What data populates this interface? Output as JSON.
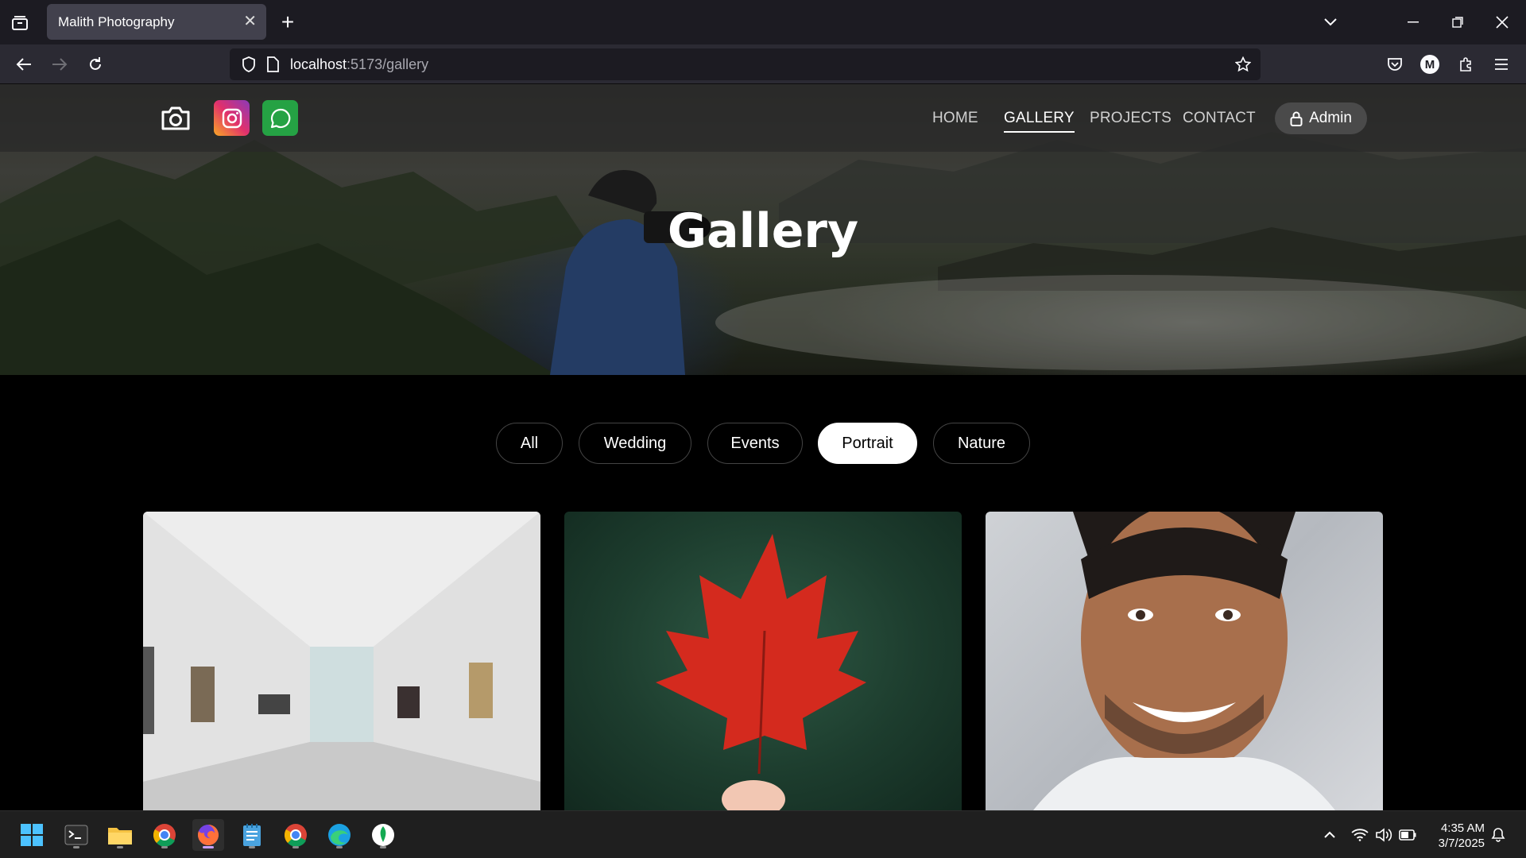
{
  "browser": {
    "tab_title": "Malith Photography",
    "url_host": "localhost",
    "url_path": ":5173/gallery",
    "profile_initial": "M"
  },
  "site": {
    "nav": [
      {
        "label": "HOME",
        "active": false
      },
      {
        "label": "GALLERY",
        "active": true
      },
      {
        "label": "PROJECTS",
        "active": false
      },
      {
        "label": "CONTACT",
        "active": false
      }
    ],
    "admin_label": "Admin",
    "hero_title": "Gallery",
    "filters": [
      {
        "label": "All",
        "active": false
      },
      {
        "label": "Wedding",
        "active": false
      },
      {
        "label": "Events",
        "active": false
      },
      {
        "label": "Portrait",
        "active": true
      },
      {
        "label": "Nature",
        "active": false
      }
    ],
    "gallery": [
      {
        "subject": "art-gallery-interior"
      },
      {
        "subject": "red-maple-leaf"
      },
      {
        "subject": "smiling-man-portrait"
      }
    ]
  },
  "taskbar": {
    "time": "4:35 AM",
    "date": "3/7/2025"
  },
  "colors": {
    "instagram": "#d6249f",
    "whatsapp": "#25a244"
  }
}
